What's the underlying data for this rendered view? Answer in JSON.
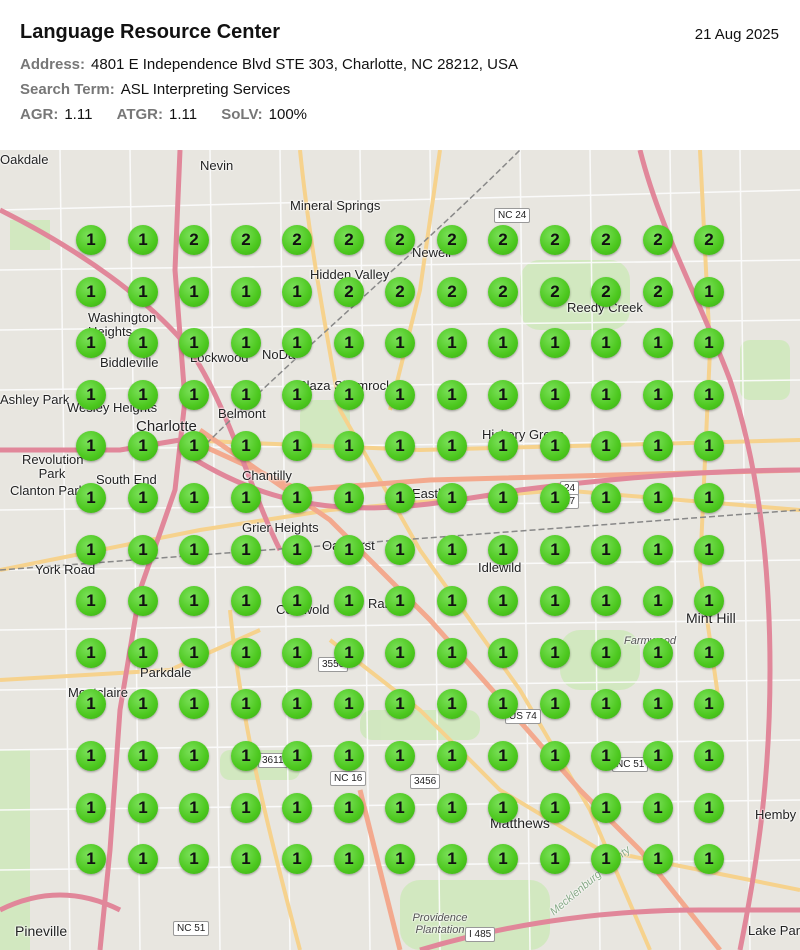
{
  "header": {
    "title": "Language Resource Center",
    "date": "21 Aug 2025",
    "address_label": "Address:",
    "address": "4801 E Independence Blvd STE 303, Charlotte, NC 28212, USA",
    "search_label": "Search Term:",
    "search_term": "ASL Interpreting Services",
    "agr_label": "AGR:",
    "agr": "1.11",
    "atgr_label": "ATGR:",
    "atgr": "1.11",
    "solv_label": "SoLV:",
    "solv": "100%"
  },
  "grid": {
    "rows": [
      [
        "1",
        "1",
        "2",
        "2",
        "2",
        "2",
        "2",
        "2",
        "2",
        "2",
        "2",
        "2",
        "2"
      ],
      [
        "1",
        "1",
        "1",
        "1",
        "1",
        "2",
        "2",
        "2",
        "2",
        "2",
        "2",
        "2",
        "1"
      ],
      [
        "1",
        "1",
        "1",
        "1",
        "1",
        "1",
        "1",
        "1",
        "1",
        "1",
        "1",
        "1",
        "1"
      ],
      [
        "1",
        "1",
        "1",
        "1",
        "1",
        "1",
        "1",
        "1",
        "1",
        "1",
        "1",
        "1",
        "1"
      ],
      [
        "1",
        "1",
        "1",
        "1",
        "1",
        "1",
        "1",
        "1",
        "1",
        "1",
        "1",
        "1",
        "1"
      ],
      [
        "1",
        "1",
        "1",
        "1",
        "1",
        "1",
        "1",
        "1",
        "1",
        "1",
        "1",
        "1",
        "1"
      ],
      [
        "1",
        "1",
        "1",
        "1",
        "1",
        "1",
        "1",
        "1",
        "1",
        "1",
        "1",
        "1",
        "1"
      ],
      [
        "1",
        "1",
        "1",
        "1",
        "1",
        "1",
        "1",
        "1",
        "1",
        "1",
        "1",
        "1",
        "1"
      ],
      [
        "1",
        "1",
        "1",
        "1",
        "1",
        "1",
        "1",
        "1",
        "1",
        "1",
        "1",
        "1",
        "1"
      ],
      [
        "1",
        "1",
        "1",
        "1",
        "1",
        "1",
        "1",
        "1",
        "1",
        "1",
        "1",
        "1",
        "1"
      ],
      [
        "1",
        "1",
        "1",
        "1",
        "1",
        "1",
        "1",
        "1",
        "1",
        "1",
        "1",
        "1",
        "1"
      ],
      [
        "1",
        "1",
        "1",
        "1",
        "1",
        "1",
        "1",
        "1",
        "1",
        "1",
        "1",
        "1",
        "1"
      ],
      [
        "1",
        "1",
        "1",
        "1",
        "1",
        "1",
        "1",
        "1",
        "1",
        "1",
        "1",
        "1",
        "1"
      ]
    ]
  },
  "map_labels": {
    "oakdale": "Oakdale",
    "nevin": "Nevin",
    "mineral_springs": "Mineral Springs",
    "hidden_valley": "Hidden Valley",
    "newell": "Newell",
    "reedy_creek": "Reedy Creek",
    "washington_heights": "Washington Heights",
    "biddleville": "Biddleville",
    "lockwood": "Lockwood",
    "noda": "NoDa",
    "ashley_park": "Ashley Park",
    "wesley_heights": "Wesley Heights",
    "belmont": "Belmont",
    "charlotte": "Charlotte",
    "plaza_shamrock": "Plaza Shamrock",
    "hickory_grove": "Hickory Grove",
    "revolution_park": "Revolution Park",
    "south_end": "South End",
    "chantilly": "Chantilly",
    "clanton_park": "Clanton Park",
    "eastland": "Eastl",
    "grier_heights": "Grier Heights",
    "oakhurst": "Oakhurst",
    "idlewild": "Idlewild",
    "york_road": "York Road",
    "randolph": "Ran",
    "cotswold": "Cotswold",
    "mint_hill": "Mint Hill",
    "farmwood": "Farmwood",
    "parkdale": "Parkdale",
    "montclaire": "Montclaire",
    "matthews": "Matthews",
    "hemby_bridge": "Hemby Br",
    "providence_plantation": "Providence Plantation",
    "pineville": "Pineville",
    "lake_park": "Lake Park",
    "mecklenburg_county": "Mecklenburg County"
  },
  "shields": {
    "nc24": "NC 24",
    "nc16": "NC 16",
    "nc51_a": "NC 51",
    "nc51_b": "NC 51",
    "r3556": "3556",
    "r3611": "3611",
    "r3456": "3456",
    "us74": "US 74",
    "i485": "I 485",
    "r24": "24",
    "r27": "27"
  },
  "colors": {
    "pin": "#4cc81e",
    "map_bg": "#e8e6e0",
    "motorway": "#e892a2",
    "trunk": "#f9b29c",
    "primary": "#fcd6a4",
    "park": "#c8e6b0"
  }
}
